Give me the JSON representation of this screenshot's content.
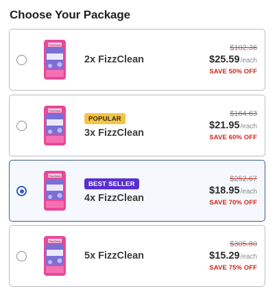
{
  "title": "Choose Your Package",
  "product_label": "FizzClean",
  "packages": [
    {
      "name": "2x FizzClean",
      "badge": "",
      "badge_type": "",
      "old_price": "$102.36",
      "price": "$25.59",
      "per": "/each",
      "save": "SAVE 50% OFF",
      "selected": false
    },
    {
      "name": "3x FizzClean",
      "badge": "POPULAR",
      "badge_type": "popular",
      "old_price": "$164.63",
      "price": "$21.95",
      "per": "/each",
      "save": "SAVE 60% OFF",
      "selected": false
    },
    {
      "name": "4x FizzClean",
      "badge": "BEST SELLER",
      "badge_type": "best",
      "old_price": "$252.67",
      "price": "$18.95",
      "per": "/each",
      "save": "SAVE 70% OFF",
      "selected": true
    },
    {
      "name": "5x FizzClean",
      "badge": "",
      "badge_type": "",
      "old_price": "$305.80",
      "price": "$15.29",
      "per": "/each",
      "save": "SAVE 75% OFF",
      "selected": false
    }
  ],
  "colors": {
    "selected_border": "#3c5a8c",
    "radio_checked": "#2e58c7",
    "save_red": "#d0241c",
    "popular_badge": "#f6c343",
    "best_badge": "#5a2fd0"
  },
  "icons": {
    "product_image": "fizzclean-pouch-icon",
    "radio": "radio-button"
  }
}
